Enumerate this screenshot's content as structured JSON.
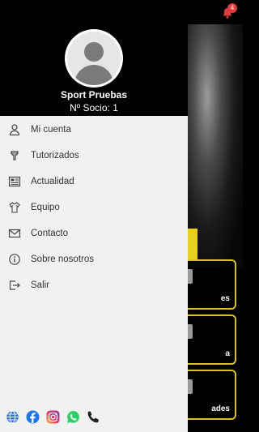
{
  "notifications": {
    "badge": "4"
  },
  "drawer": {
    "user": {
      "name": "Sport Pruebas",
      "member_label": "Nº Socio: 1"
    },
    "menu": [
      {
        "icon": "user-icon",
        "label": "Mi cuenta"
      },
      {
        "icon": "whistle-icon",
        "label": "Tutorizados"
      },
      {
        "icon": "newspaper-icon",
        "label": "Actualidad"
      },
      {
        "icon": "shirt-icon",
        "label": "Equipo"
      },
      {
        "icon": "envelope-icon",
        "label": "Contacto"
      },
      {
        "icon": "info-icon",
        "label": "Sobre nosotros"
      },
      {
        "icon": "logout-icon",
        "label": "Salir"
      }
    ],
    "social": [
      {
        "icon": "globe-icon",
        "color": "#2f6fd6"
      },
      {
        "icon": "facebook-icon",
        "color": "#1877f2"
      },
      {
        "icon": "instagram-icon",
        "color": "#d6249f"
      },
      {
        "icon": "whatsapp-icon",
        "color": "#25d366"
      },
      {
        "icon": "phone-icon",
        "color": "#222222"
      }
    ]
  },
  "background": {
    "cards": [
      {
        "label": "es"
      },
      {
        "label": "a"
      },
      {
        "label": "ades"
      }
    ],
    "accent": "#e7d21a"
  }
}
